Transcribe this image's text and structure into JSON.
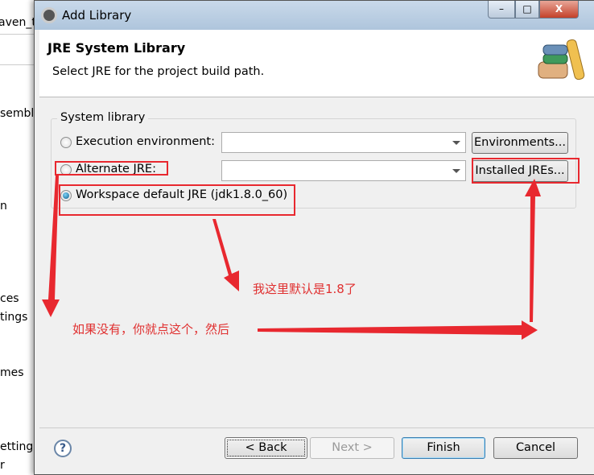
{
  "background_window": {
    "fragments": [
      "aven_t",
      "sembl",
      "n",
      "ces",
      "tings",
      "mes",
      "ettings",
      "r"
    ]
  },
  "dialog": {
    "title": "Add Library",
    "window_buttons": {
      "minimize": "–",
      "maximize": "□",
      "close": "X"
    },
    "header": {
      "title": "JRE System Library",
      "description": "Select JRE for the project build path."
    },
    "group_label": "System library",
    "options": [
      {
        "label": "Execution environment:",
        "selected": false,
        "combo_value": "",
        "button": "Environments..."
      },
      {
        "label": "Alternate JRE:",
        "selected": false,
        "combo_value": "",
        "button": "Installed JREs..."
      },
      {
        "label": "Workspace default JRE (jdk1.8.0_60)",
        "selected": true
      }
    ],
    "footer": {
      "help_icon": "?",
      "back": "< Back",
      "next": "Next >",
      "finish": "Finish",
      "cancel": "Cancel"
    }
  },
  "annotations": {
    "note1": "我这里默认是1.8了",
    "note2": "如果没有，你就点这个，然后",
    "color": "#e8282f"
  }
}
